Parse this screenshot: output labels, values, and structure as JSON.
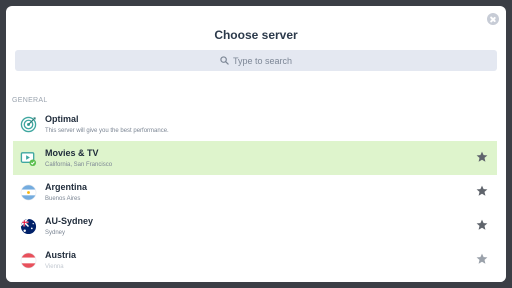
{
  "dialog": {
    "title": "Choose server",
    "close_icon": "close-icon"
  },
  "search": {
    "placeholder": "Type to search",
    "icon": "search-icon"
  },
  "section_label": "GENERAL",
  "servers": [
    {
      "name": "Optimal",
      "subtitle": "This server will give you the best performance.",
      "icon": "target-icon",
      "selected": false,
      "favorite_star": false
    },
    {
      "name": "Movies & TV",
      "subtitle": "California, San Francisco",
      "icon": "streaming-icon",
      "selected": true,
      "favorite_star": true
    },
    {
      "name": "Argentina",
      "subtitle": "Buenos Aires",
      "icon": "flag-argentina-icon",
      "selected": false,
      "favorite_star": true
    },
    {
      "name": "AU-Sydney",
      "subtitle": "Sydney",
      "icon": "flag-australia-icon",
      "selected": false,
      "favorite_star": true
    },
    {
      "name": "Austria",
      "subtitle": "Vienna",
      "icon": "flag-austria-icon",
      "selected": false,
      "favorite_star": true
    }
  ],
  "colors": {
    "selected_row": "#def4cc",
    "search_bg": "#e4e8f1",
    "star": "#5f646c"
  }
}
